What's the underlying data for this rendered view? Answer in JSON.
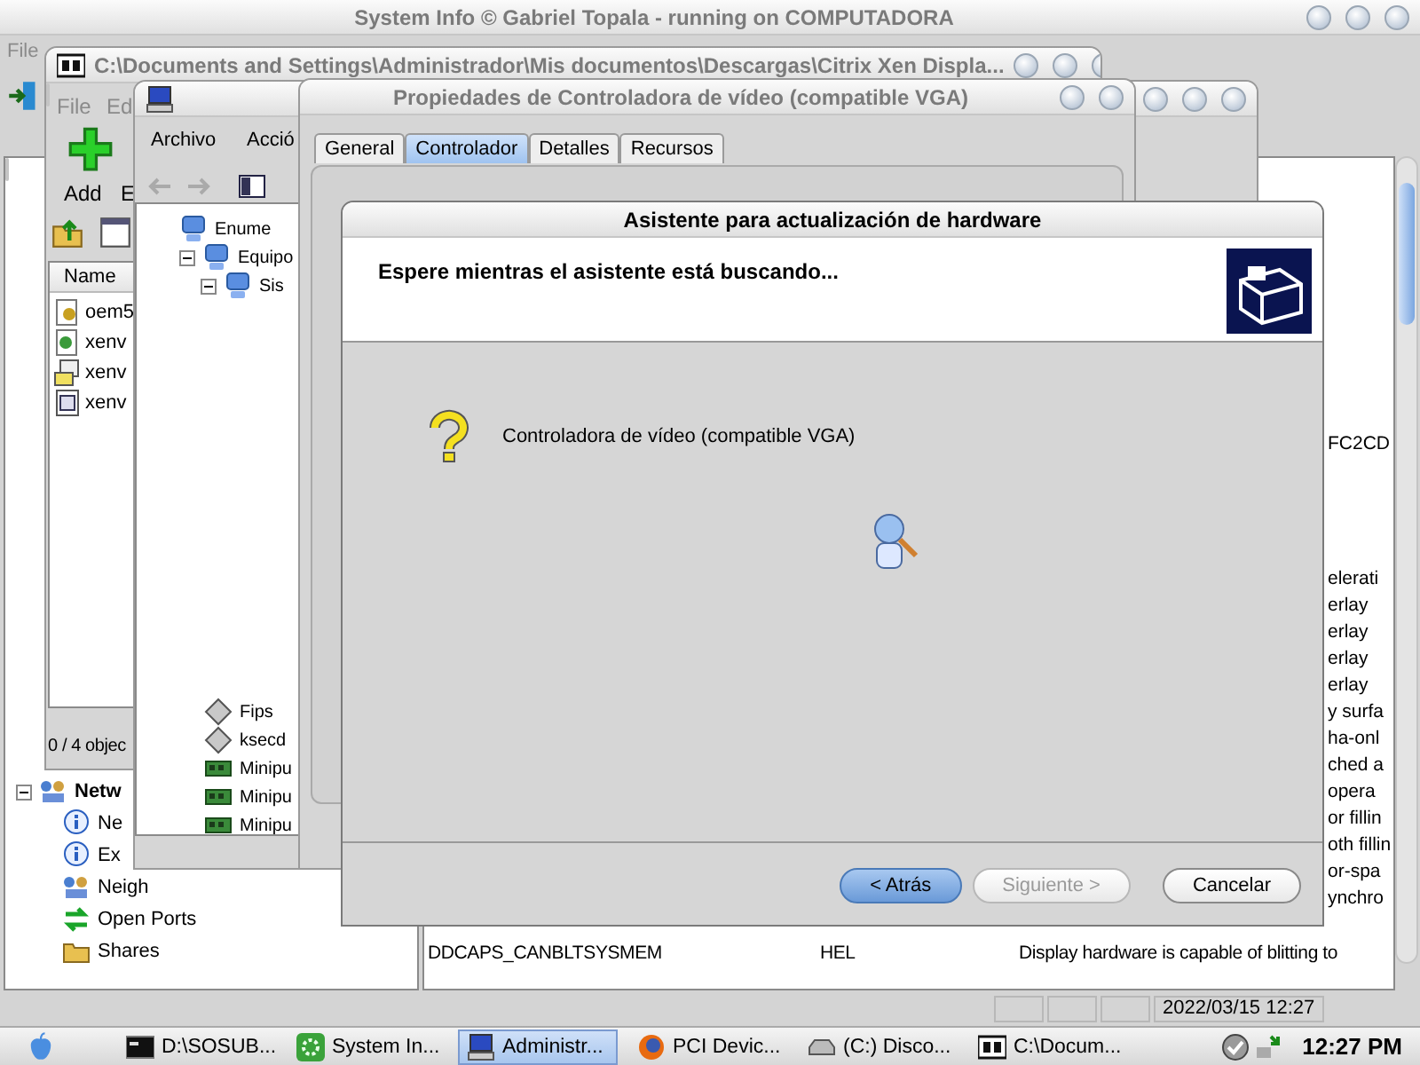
{
  "main_window": {
    "title": "System Info  © Gabriel Topala - running on COMPUTADORA",
    "menu": [
      "File"
    ],
    "tree": [
      {
        "label": "Netw",
        "kind": "network",
        "expanded": true,
        "children": [
          {
            "label": "Ne",
            "kind": "info"
          },
          {
            "label": "Ex",
            "kind": "info"
          },
          {
            "label": "Neigh",
            "kind": "network"
          },
          {
            "label": "Open Ports",
            "kind": "ports"
          },
          {
            "label": "Shares",
            "kind": "shares"
          }
        ]
      }
    ],
    "id_fragment": "FC2CD",
    "description_fragments": [
      "elerati",
      "erlay",
      "erlay",
      "erlay",
      "erlay",
      "y surfa",
      "ha-onl",
      "ched a",
      "opera",
      "or fillin",
      "oth fillin",
      "or-spa",
      "ynchro"
    ],
    "rows": [
      {
        "name": "DDCAPS_CANBLTSYSMEM",
        "type": "HEL",
        "description": "Display hardware is capable of blitting to"
      }
    ],
    "status_bar": "2022/03/15 12:27"
  },
  "archive_window": {
    "title": "C:\\Documents and Settings\\Administrador\\Mis documentos\\Descargas\\Citrix Xen Displa...",
    "menu": [
      "File",
      "Ed"
    ],
    "toolbar": [
      "Add",
      "E"
    ],
    "column": "Name",
    "files": [
      {
        "name": "oem5",
        "kind": "setup"
      },
      {
        "name": "xenv",
        "kind": "package"
      },
      {
        "name": "xenv",
        "kind": "install"
      },
      {
        "name": "xenv",
        "kind": "config"
      }
    ],
    "status": "0 / 4 objec"
  },
  "device_manager": {
    "menu": [
      "Archivo",
      "Acció"
    ],
    "tree": [
      {
        "label": "Enume",
        "kind": "device"
      },
      {
        "label": "Equipo",
        "kind": "device",
        "expanded": true,
        "children": [
          {
            "label": "Sis",
            "kind": "device",
            "expanded": true
          }
        ]
      }
    ],
    "drivers": [
      {
        "label": "Fips",
        "kind": "driver"
      },
      {
        "label": "ksecd",
        "kind": "driver"
      },
      {
        "label": "Minipu",
        "kind": "adapter"
      },
      {
        "label": "Minipu",
        "kind": "adapter"
      },
      {
        "label": "Minipu",
        "kind": "adapter"
      }
    ]
  },
  "properties_window": {
    "title": "Propiedades de Controladora de vídeo (compatible VGA)",
    "tabs": [
      {
        "label": "General",
        "selected": false
      },
      {
        "label": "Controlador",
        "selected": true
      },
      {
        "label": "Detalles",
        "selected": false
      },
      {
        "label": "Recursos",
        "selected": false
      }
    ]
  },
  "wizard": {
    "title": "Asistente para actualización de hardware",
    "heading": "Espere mientras el asistente está buscando...",
    "device": "Controladora de vídeo (compatible VGA)",
    "buttons": [
      {
        "label": "< Atrás",
        "default": true,
        "disabled": false
      },
      {
        "label": "Siguiente >",
        "default": false,
        "disabled": true
      },
      {
        "label": "Cancelar",
        "default": false,
        "disabled": false
      }
    ]
  },
  "taskbar": {
    "tasks": [
      {
        "label": "D:\\SOSUB...",
        "kind": "console",
        "selected": false
      },
      {
        "label": "System In...",
        "kind": "sysinfo",
        "selected": false
      },
      {
        "label": "Administr...",
        "kind": "computer",
        "selected": true
      },
      {
        "label": "PCI Devic...",
        "kind": "browser",
        "selected": false
      },
      {
        "label": "(C:) Disco...",
        "kind": "drive",
        "selected": false
      },
      {
        "label": "C:\\Docum...",
        "kind": "archive",
        "selected": false
      }
    ],
    "clock": "12:27 PM"
  }
}
